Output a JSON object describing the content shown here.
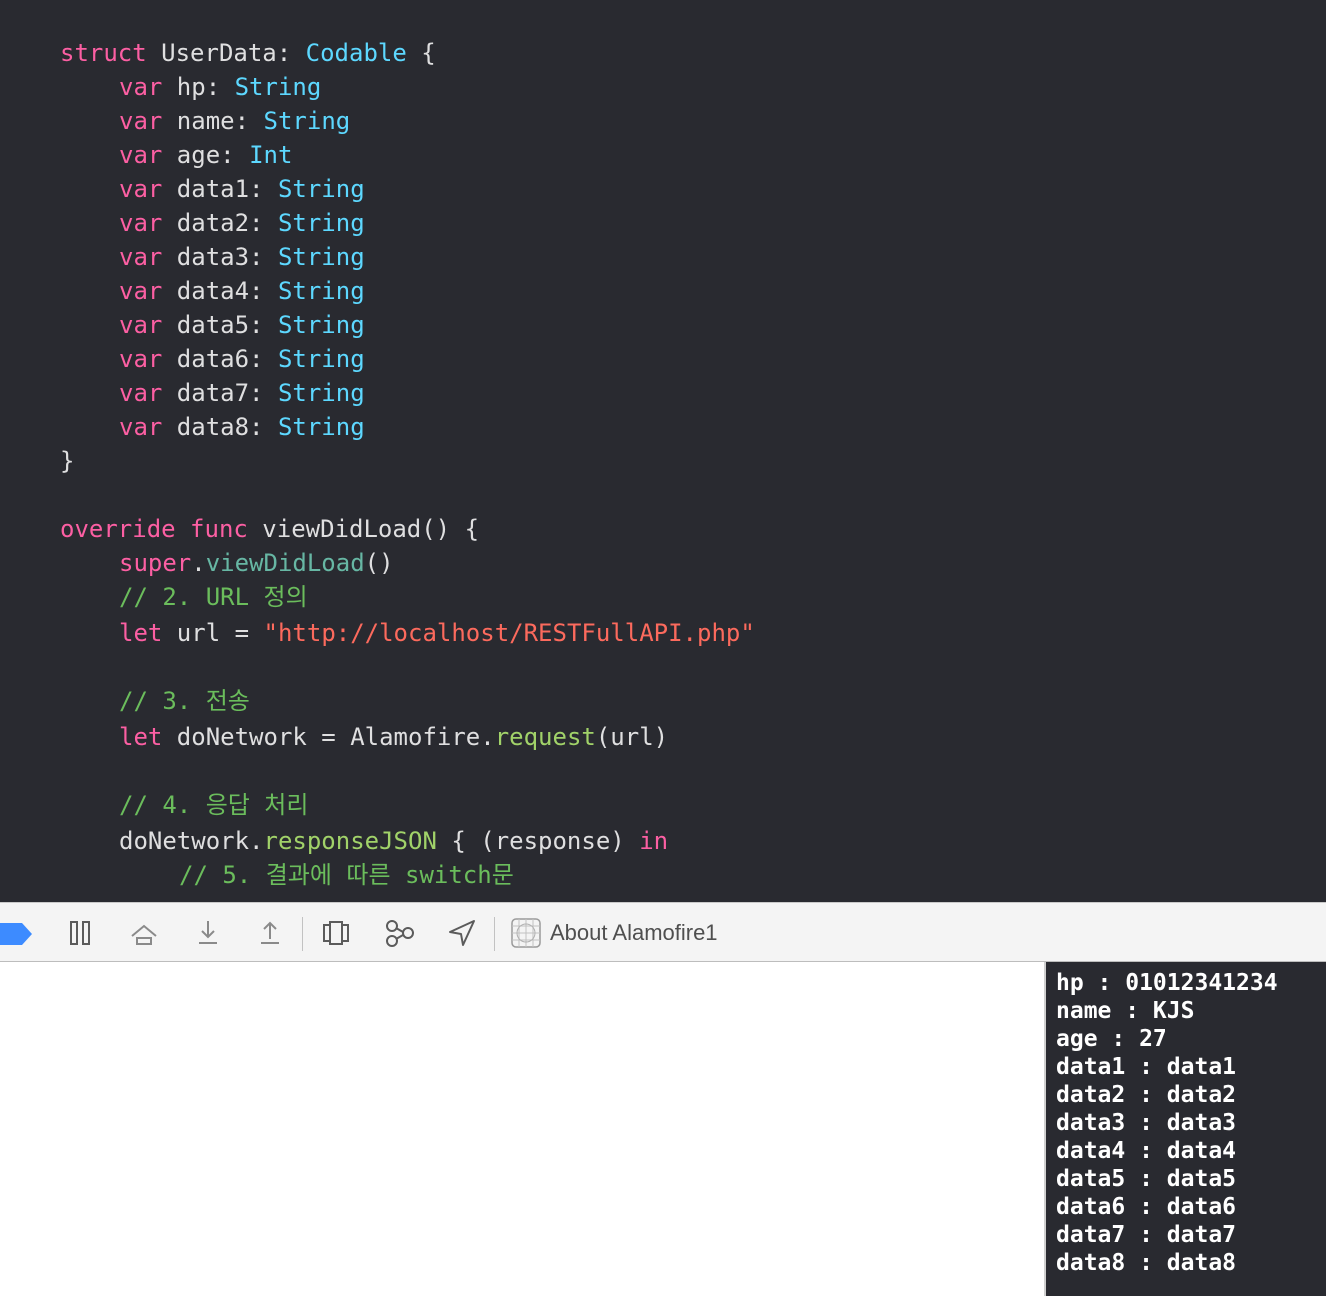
{
  "editor": {
    "lines": [
      {
        "indent": 0,
        "tokens": [
          {
            "t": "struct",
            "c": "kw"
          },
          {
            "t": " UserData: ",
            "c": "tx"
          },
          {
            "t": "Codable",
            "c": "ty"
          },
          {
            "t": " {",
            "c": "tx"
          }
        ]
      },
      {
        "indent": 1,
        "tokens": [
          {
            "t": "var",
            "c": "kw"
          },
          {
            "t": " hp: ",
            "c": "tx"
          },
          {
            "t": "String",
            "c": "ty"
          }
        ]
      },
      {
        "indent": 1,
        "tokens": [
          {
            "t": "var",
            "c": "kw"
          },
          {
            "t": " name: ",
            "c": "tx"
          },
          {
            "t": "String",
            "c": "ty"
          }
        ]
      },
      {
        "indent": 1,
        "tokens": [
          {
            "t": "var",
            "c": "kw"
          },
          {
            "t": " age: ",
            "c": "tx"
          },
          {
            "t": "Int",
            "c": "ty"
          }
        ]
      },
      {
        "indent": 1,
        "tokens": [
          {
            "t": "var",
            "c": "kw"
          },
          {
            "t": " data1: ",
            "c": "tx"
          },
          {
            "t": "String",
            "c": "ty"
          }
        ]
      },
      {
        "indent": 1,
        "tokens": [
          {
            "t": "var",
            "c": "kw"
          },
          {
            "t": " data2: ",
            "c": "tx"
          },
          {
            "t": "String",
            "c": "ty"
          }
        ]
      },
      {
        "indent": 1,
        "tokens": [
          {
            "t": "var",
            "c": "kw"
          },
          {
            "t": " data3: ",
            "c": "tx"
          },
          {
            "t": "String",
            "c": "ty"
          }
        ]
      },
      {
        "indent": 1,
        "tokens": [
          {
            "t": "var",
            "c": "kw"
          },
          {
            "t": " data4: ",
            "c": "tx"
          },
          {
            "t": "String",
            "c": "ty"
          }
        ]
      },
      {
        "indent": 1,
        "tokens": [
          {
            "t": "var",
            "c": "kw"
          },
          {
            "t": " data5: ",
            "c": "tx"
          },
          {
            "t": "String",
            "c": "ty"
          }
        ]
      },
      {
        "indent": 1,
        "tokens": [
          {
            "t": "var",
            "c": "kw"
          },
          {
            "t": " data6: ",
            "c": "tx"
          },
          {
            "t": "String",
            "c": "ty"
          }
        ]
      },
      {
        "indent": 1,
        "tokens": [
          {
            "t": "var",
            "c": "kw"
          },
          {
            "t": " data7: ",
            "c": "tx"
          },
          {
            "t": "String",
            "c": "ty"
          }
        ]
      },
      {
        "indent": 1,
        "tokens": [
          {
            "t": "var",
            "c": "kw"
          },
          {
            "t": " data8: ",
            "c": "tx"
          },
          {
            "t": "String",
            "c": "ty"
          }
        ]
      },
      {
        "indent": 0,
        "tokens": [
          {
            "t": "}",
            "c": "tx"
          }
        ]
      },
      {
        "indent": 0,
        "tokens": [
          {
            "t": "override",
            "c": "kw"
          },
          {
            "t": " ",
            "c": "tx"
          },
          {
            "t": "func",
            "c": "kw"
          },
          {
            "t": " viewDidLoad() {",
            "c": "tx"
          }
        ]
      },
      {
        "indent": 1,
        "tokens": [
          {
            "t": "super",
            "c": "kw"
          },
          {
            "t": ".",
            "c": "tx"
          },
          {
            "t": "viewDidLoad",
            "c": "fn"
          },
          {
            "t": "()",
            "c": "tx"
          }
        ]
      },
      {
        "indent": 1,
        "tokens": [
          {
            "t": "// 2. URL 정의",
            "c": "cm"
          }
        ]
      },
      {
        "indent": 1,
        "tokens": [
          {
            "t": "let",
            "c": "kw"
          },
          {
            "t": " url = ",
            "c": "tx"
          },
          {
            "t": "\"http://localhost/RESTFullAPI.php\"",
            "c": "st"
          }
        ]
      },
      {
        "indent": 1,
        "tokens": [
          {
            "t": "// 3. 전송",
            "c": "cm"
          }
        ]
      },
      {
        "indent": 1,
        "tokens": [
          {
            "t": "let",
            "c": "kw"
          },
          {
            "t": " doNetwork = Alamofire.",
            "c": "tx"
          },
          {
            "t": "request",
            "c": "mt"
          },
          {
            "t": "(url)",
            "c": "tx"
          }
        ]
      },
      {
        "indent": 1,
        "tokens": [
          {
            "t": "// 4. 응답 처리",
            "c": "cm"
          }
        ]
      },
      {
        "indent": 1,
        "tokens": [
          {
            "t": "doNetwork.",
            "c": "tx"
          },
          {
            "t": "responseJSON",
            "c": "mt"
          },
          {
            "t": " { (response) ",
            "c": "tx"
          },
          {
            "t": "in",
            "c": "kw"
          }
        ]
      },
      {
        "indent": 2,
        "tokens": [
          {
            "t": "// 5. 결과에 따른 switch문",
            "c": "cm"
          }
        ]
      }
    ]
  },
  "debug_bar": {
    "target_label": "About Alamofire1",
    "buttons": [
      {
        "name": "continue-icon"
      },
      {
        "name": "step-over-icon"
      },
      {
        "name": "step-into-icon"
      },
      {
        "name": "step-out-icon"
      },
      {
        "name": "debug-view-hierarchy-icon"
      },
      {
        "name": "memory-graph-icon"
      },
      {
        "name": "simulate-location-icon"
      }
    ],
    "colors": {
      "breakpoint": "#3d8bff",
      "icon": "#5b5b5b"
    }
  },
  "console": {
    "lines": [
      "hp : 01012341234",
      "name : KJS",
      "age : 27",
      "data1 : data1",
      "data2 : data2",
      "data3 : data3",
      "data4 : data4",
      "data5 : data5",
      "data6 : data6",
      "data7 : data7",
      "data8 : data8"
    ]
  },
  "colors": {
    "editor_bg": "#292a30",
    "keyword": "#fc5fa3",
    "type": "#5dd8ff",
    "comment": "#6bbd5c",
    "string": "#fc6a5d",
    "method": "#a1d269",
    "plain": "#dfdfe0"
  }
}
